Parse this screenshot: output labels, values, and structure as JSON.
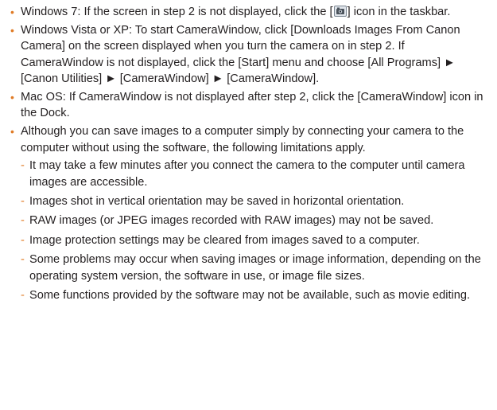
{
  "bullet_char": "•",
  "dash_char": "-",
  "accent_color": "#e07b26",
  "items": {
    "win7": {
      "before_icon": "Windows 7: If the screen in step 2 is not displayed, click the [",
      "icon": "camerawindow-taskbar-icon",
      "after_icon": "] icon in the taskbar."
    },
    "vista": "Windows Vista or XP: To start CameraWindow, click [Downloads Images From Canon Camera] on the screen displayed when you turn the camera on in step 2. If CameraWindow is not displayed, click the [Start] menu and choose [All Programs] ► [Canon Utilities] ► [CameraWindow] ► [CameraWindow].",
    "mac": "Mac OS: If CameraWindow is not displayed after step 2, click the [CameraWindow] icon in the Dock.",
    "limitations": "Although you can save images to a computer simply by connecting your camera to the computer without using the software, the following limitations apply."
  },
  "sub_items": [
    "It may take a few minutes after you connect the camera to the computer until camera images are accessible.",
    "Images shot in vertical orientation may be saved in horizontal orientation.",
    "RAW images (or JPEG images recorded with RAW images) may not be saved.",
    "Image protection settings may be cleared from images saved to a computer.",
    "Some problems may occur when saving images or image information, depending on the operating system version, the software in use, or image file sizes.",
    "Some functions provided by the software may not be available, such as movie editing."
  ]
}
